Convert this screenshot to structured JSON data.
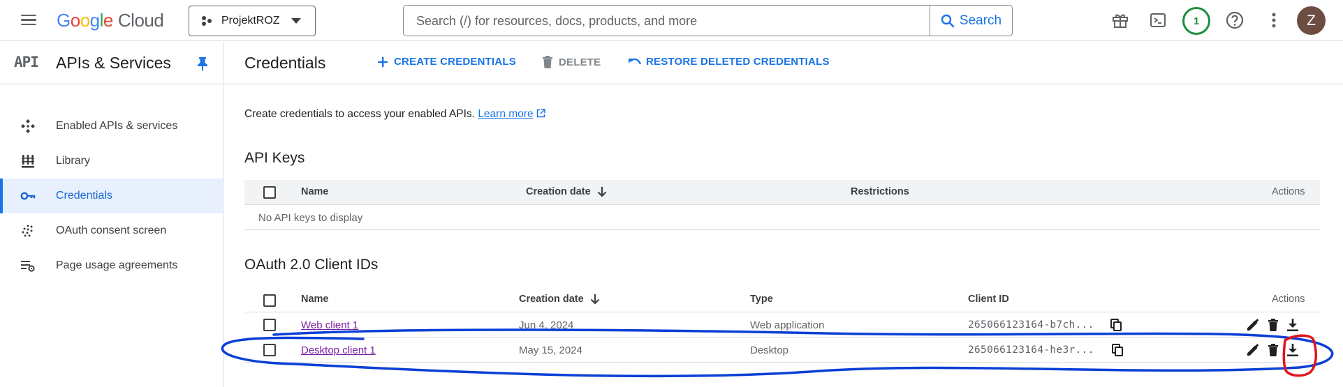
{
  "topbar": {
    "logo_google": "Google",
    "logo_cloud": "Cloud",
    "project_name": "ProjektROZ",
    "search_placeholder": "Search (/) for resources, docs, products, and more",
    "search_label": "Search",
    "notifications_count": "1",
    "avatar_letter": "Z"
  },
  "sidebar": {
    "logo_text": "API",
    "title": "APIs & Services",
    "items": [
      {
        "label": "Enabled APIs & services",
        "icon": "hub-icon",
        "active": false
      },
      {
        "label": "Library",
        "icon": "library-icon",
        "active": false
      },
      {
        "label": "Credentials",
        "icon": "key-icon",
        "active": true
      },
      {
        "label": "OAuth consent screen",
        "icon": "oauth-dots-icon",
        "active": false
      },
      {
        "label": "Page usage agreements",
        "icon": "settings-list-icon",
        "active": false
      }
    ]
  },
  "main": {
    "title": "Credentials",
    "actions": {
      "create": "CREATE CREDENTIALS",
      "delete": "DELETE",
      "restore": "RESTORE DELETED CREDENTIALS"
    },
    "intro_text": "Create credentials to access your enabled APIs.",
    "learn_more": "Learn more",
    "api_keys": {
      "title": "API Keys",
      "columns": {
        "name": "Name",
        "created": "Creation date",
        "restrictions": "Restrictions",
        "actions": "Actions"
      },
      "empty": "No API keys to display"
    },
    "oauth": {
      "title": "OAuth 2.0 Client IDs",
      "columns": {
        "name": "Name",
        "created": "Creation date",
        "type": "Type",
        "client_id": "Client ID",
        "actions": "Actions"
      },
      "rows": [
        {
          "name": "Web client 1",
          "created": "Jun 4, 2024",
          "type": "Web application",
          "client_id": "265066123164-b7ch..."
        },
        {
          "name": "Desktop client 1",
          "created": "May 15, 2024",
          "type": "Desktop",
          "client_id": "265066123164-he3r..."
        }
      ]
    }
  },
  "colors": {
    "accent": "#1a73e8",
    "link_visited": "#7b1fa2",
    "annotation_blue": "#0b3fd6",
    "annotation_red": "#e3141b"
  }
}
